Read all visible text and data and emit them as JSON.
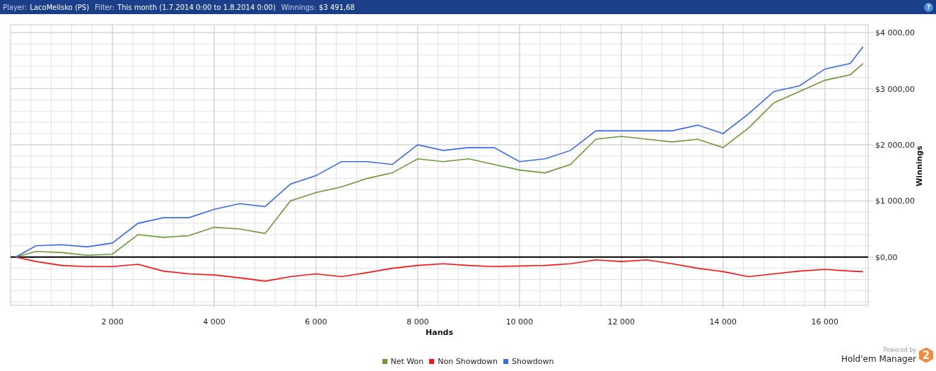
{
  "header": {
    "fields": [
      {
        "label": "Player:",
        "value": "LacoMelisko (PS)"
      },
      {
        "label": "Filter:",
        "value": "This month (1.7.2014 0:00 to 1.8.2014 0:00)"
      },
      {
        "label": "Winnings:",
        "value": "$3 491,68"
      }
    ],
    "help": "?"
  },
  "chart": {
    "chart_data": {
      "type": "line",
      "grid": true,
      "xlabel": "Hands",
      "ylabel": "Winnings",
      "x": [
        100,
        500,
        1000,
        1500,
        2000,
        2500,
        3000,
        3500,
        4000,
        4500,
        5000,
        5500,
        6000,
        6500,
        7000,
        7500,
        8000,
        8500,
        9000,
        9500,
        10000,
        10500,
        11000,
        11500,
        12000,
        12500,
        13000,
        13500,
        14000,
        14500,
        15000,
        15500,
        16000,
        16500,
        16750
      ],
      "series": [
        {
          "name": "Net Won",
          "color": "#6a9a34",
          "values": [
            0,
            100,
            80,
            30,
            50,
            400,
            350,
            380,
            530,
            500,
            420,
            1000,
            1150,
            1250,
            1400,
            1500,
            1750,
            1700,
            1750,
            1650,
            1550,
            1500,
            1650,
            2100,
            2150,
            2100,
            2050,
            2100,
            1950,
            2300,
            2750,
            2950,
            3150,
            3250,
            3450
          ]
        },
        {
          "name": "Non Showdown",
          "color": "#ff1010",
          "values": [
            0,
            -80,
            -150,
            -170,
            -170,
            -130,
            -250,
            -300,
            -320,
            -370,
            -430,
            -350,
            -300,
            -350,
            -280,
            -200,
            -150,
            -120,
            -150,
            -170,
            -160,
            -150,
            -120,
            -50,
            -80,
            -50,
            -120,
            -200,
            -260,
            -350,
            -300,
            -250,
            -220,
            -250,
            -260
          ]
        },
        {
          "name": "Showdown",
          "color": "#3a6af0",
          "values": [
            0,
            200,
            220,
            180,
            250,
            600,
            700,
            700,
            850,
            950,
            900,
            1300,
            1450,
            1700,
            1700,
            1650,
            2000,
            1900,
            1950,
            1950,
            1700,
            1750,
            1900,
            2250,
            2250,
            2250,
            2250,
            2350,
            2200,
            2550,
            2950,
            3050,
            3350,
            3450,
            3750
          ]
        }
      ],
      "xlim": [
        0,
        16850
      ],
      "ylim": [
        -860,
        4140
      ],
      "xticks": [
        {
          "value": 2000,
          "label": "2 000"
        },
        {
          "value": 4000,
          "label": "4 000"
        },
        {
          "value": 6000,
          "label": "6 000"
        },
        {
          "value": 8000,
          "label": "8 000"
        },
        {
          "value": 10000,
          "label": "10 000"
        },
        {
          "value": 12000,
          "label": "12 000"
        },
        {
          "value": 14000,
          "label": "14 000"
        },
        {
          "value": 16000,
          "label": "16 000"
        }
      ],
      "yticks": [
        {
          "value": 0,
          "label": "$0,00"
        },
        {
          "value": 1000,
          "label": "$1 000,00"
        },
        {
          "value": 2000,
          "label": "$2 000,00"
        },
        {
          "value": 3000,
          "label": "$3 000,00"
        },
        {
          "value": 4000,
          "label": "$4 000,00"
        }
      ]
    }
  },
  "branding": {
    "powered": "Powered by",
    "product": "Hold'em Manager",
    "badge": "2"
  }
}
